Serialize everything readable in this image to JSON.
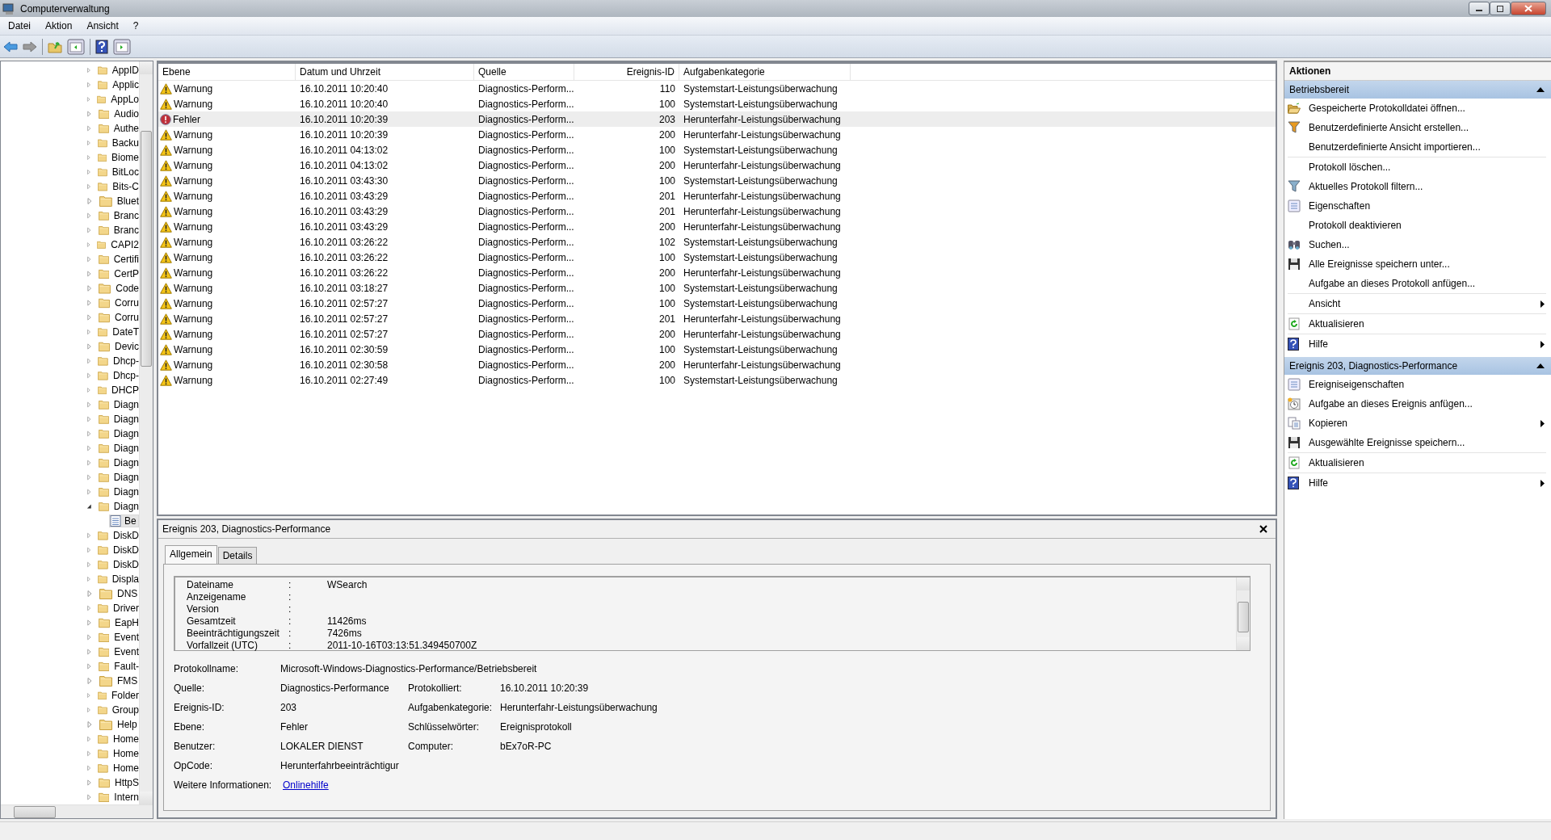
{
  "window": {
    "title": "Computerverwaltung"
  },
  "menu": [
    "Datei",
    "Aktion",
    "Ansicht",
    "?"
  ],
  "tree": {
    "items": [
      {
        "label": "AppID",
        "expanded": false
      },
      {
        "label": "Applic",
        "expanded": false
      },
      {
        "label": "AppLo",
        "expanded": false
      },
      {
        "label": "Audio",
        "expanded": false
      },
      {
        "label": "Authe",
        "expanded": false
      },
      {
        "label": "Backu",
        "expanded": false
      },
      {
        "label": "Biome",
        "expanded": false
      },
      {
        "label": "BitLoc",
        "expanded": false
      },
      {
        "label": "Bits-C",
        "expanded": false
      },
      {
        "label": "Bluet",
        "expanded": false
      },
      {
        "label": "Branc",
        "expanded": false
      },
      {
        "label": "Branc",
        "expanded": false
      },
      {
        "label": "CAPI2",
        "expanded": false
      },
      {
        "label": "Certifi",
        "expanded": false
      },
      {
        "label": "CertP",
        "expanded": false
      },
      {
        "label": "Code",
        "expanded": false
      },
      {
        "label": "Corru",
        "expanded": false
      },
      {
        "label": "Corru",
        "expanded": false
      },
      {
        "label": "DateT",
        "expanded": false
      },
      {
        "label": "Devic",
        "expanded": false
      },
      {
        "label": "Dhcp-",
        "expanded": false
      },
      {
        "label": "Dhcp-",
        "expanded": false
      },
      {
        "label": "DHCP",
        "expanded": false
      },
      {
        "label": "Diagn",
        "expanded": false
      },
      {
        "label": "Diagn",
        "expanded": false
      },
      {
        "label": "Diagn",
        "expanded": false
      },
      {
        "label": "Diagn",
        "expanded": false
      },
      {
        "label": "Diagn",
        "expanded": false
      },
      {
        "label": "Diagn",
        "expanded": false
      },
      {
        "label": "Diagn",
        "expanded": false
      },
      {
        "label": "Diagn",
        "expanded": true,
        "children": [
          {
            "label": "Be",
            "selected": true
          }
        ]
      },
      {
        "label": "DiskD",
        "expanded": false
      },
      {
        "label": "DiskD",
        "expanded": false
      },
      {
        "label": "DiskD",
        "expanded": false
      },
      {
        "label": "Displa",
        "expanded": false
      },
      {
        "label": "DNS",
        "expanded": false
      },
      {
        "label": "Driver",
        "expanded": false
      },
      {
        "label": "EapH",
        "expanded": false
      },
      {
        "label": "Event",
        "expanded": false
      },
      {
        "label": "Event",
        "expanded": false
      },
      {
        "label": "Fault-",
        "expanded": false
      },
      {
        "label": "FMS",
        "expanded": false
      },
      {
        "label": "Folder",
        "expanded": false
      },
      {
        "label": "Group",
        "expanded": false
      },
      {
        "label": "Help",
        "expanded": false
      },
      {
        "label": "Home",
        "expanded": false
      },
      {
        "label": "Home",
        "expanded": false
      },
      {
        "label": "Home",
        "expanded": false
      },
      {
        "label": "HttpS",
        "expanded": false
      },
      {
        "label": "Intern",
        "expanded": false
      }
    ]
  },
  "events": {
    "columns": [
      "Ebene",
      "Datum und Uhrzeit",
      "Quelle",
      "Ereignis-ID",
      "Aufgabenkategorie"
    ],
    "rows": [
      {
        "kind": "warning",
        "level": "Warnung",
        "datetime": "16.10.2011 10:20:40",
        "source": "Diagnostics-Perform...",
        "id": "110",
        "category": "Systemstart-Leistungsüberwachung",
        "selected": false
      },
      {
        "kind": "warning",
        "level": "Warnung",
        "datetime": "16.10.2011 10:20:40",
        "source": "Diagnostics-Perform...",
        "id": "100",
        "category": "Systemstart-Leistungsüberwachung",
        "selected": false
      },
      {
        "kind": "error",
        "level": "Fehler",
        "datetime": "16.10.2011 10:20:39",
        "source": "Diagnostics-Perform...",
        "id": "203",
        "category": "Herunterfahr-Leistungsüberwachung",
        "selected": true
      },
      {
        "kind": "warning",
        "level": "Warnung",
        "datetime": "16.10.2011 10:20:39",
        "source": "Diagnostics-Perform...",
        "id": "200",
        "category": "Herunterfahr-Leistungsüberwachung",
        "selected": false
      },
      {
        "kind": "warning",
        "level": "Warnung",
        "datetime": "16.10.2011 04:13:02",
        "source": "Diagnostics-Perform...",
        "id": "100",
        "category": "Systemstart-Leistungsüberwachung",
        "selected": false
      },
      {
        "kind": "warning",
        "level": "Warnung",
        "datetime": "16.10.2011 04:13:02",
        "source": "Diagnostics-Perform...",
        "id": "200",
        "category": "Herunterfahr-Leistungsüberwachung",
        "selected": false
      },
      {
        "kind": "warning",
        "level": "Warnung",
        "datetime": "16.10.2011 03:43:30",
        "source": "Diagnostics-Perform...",
        "id": "100",
        "category": "Systemstart-Leistungsüberwachung",
        "selected": false
      },
      {
        "kind": "warning",
        "level": "Warnung",
        "datetime": "16.10.2011 03:43:29",
        "source": "Diagnostics-Perform...",
        "id": "201",
        "category": "Herunterfahr-Leistungsüberwachung",
        "selected": false
      },
      {
        "kind": "warning",
        "level": "Warnung",
        "datetime": "16.10.2011 03:43:29",
        "source": "Diagnostics-Perform...",
        "id": "201",
        "category": "Herunterfahr-Leistungsüberwachung",
        "selected": false
      },
      {
        "kind": "warning",
        "level": "Warnung",
        "datetime": "16.10.2011 03:43:29",
        "source": "Diagnostics-Perform...",
        "id": "200",
        "category": "Herunterfahr-Leistungsüberwachung",
        "selected": false
      },
      {
        "kind": "warning",
        "level": "Warnung",
        "datetime": "16.10.2011 03:26:22",
        "source": "Diagnostics-Perform...",
        "id": "102",
        "category": "Systemstart-Leistungsüberwachung",
        "selected": false
      },
      {
        "kind": "warning",
        "level": "Warnung",
        "datetime": "16.10.2011 03:26:22",
        "source": "Diagnostics-Perform...",
        "id": "100",
        "category": "Systemstart-Leistungsüberwachung",
        "selected": false
      },
      {
        "kind": "warning",
        "level": "Warnung",
        "datetime": "16.10.2011 03:26:22",
        "source": "Diagnostics-Perform...",
        "id": "200",
        "category": "Herunterfahr-Leistungsüberwachung",
        "selected": false
      },
      {
        "kind": "warning",
        "level": "Warnung",
        "datetime": "16.10.2011 03:18:27",
        "source": "Diagnostics-Perform...",
        "id": "100",
        "category": "Systemstart-Leistungsüberwachung",
        "selected": false
      },
      {
        "kind": "warning",
        "level": "Warnung",
        "datetime": "16.10.2011 02:57:27",
        "source": "Diagnostics-Perform...",
        "id": "100",
        "category": "Systemstart-Leistungsüberwachung",
        "selected": false
      },
      {
        "kind": "warning",
        "level": "Warnung",
        "datetime": "16.10.2011 02:57:27",
        "source": "Diagnostics-Perform...",
        "id": "201",
        "category": "Herunterfahr-Leistungsüberwachung",
        "selected": false
      },
      {
        "kind": "warning",
        "level": "Warnung",
        "datetime": "16.10.2011 02:57:27",
        "source": "Diagnostics-Perform...",
        "id": "200",
        "category": "Herunterfahr-Leistungsüberwachung",
        "selected": false
      },
      {
        "kind": "warning",
        "level": "Warnung",
        "datetime": "16.10.2011 02:30:59",
        "source": "Diagnostics-Perform...",
        "id": "100",
        "category": "Systemstart-Leistungsüberwachung",
        "selected": false
      },
      {
        "kind": "warning",
        "level": "Warnung",
        "datetime": "16.10.2011 02:30:58",
        "source": "Diagnostics-Perform...",
        "id": "200",
        "category": "Herunterfahr-Leistungsüberwachung",
        "selected": false
      },
      {
        "kind": "warning",
        "level": "Warnung",
        "datetime": "16.10.2011 02:27:49",
        "source": "Diagnostics-Perform...",
        "id": "100",
        "category": "Systemstart-Leistungsüberwachung",
        "selected": false
      }
    ]
  },
  "detail": {
    "title": "Ereignis 203, Diagnostics-Performance",
    "tabs": [
      {
        "label": "Allgemein",
        "selected": true
      },
      {
        "label": "Details",
        "selected": false
      }
    ],
    "data_lines": [
      {
        "name": "Dateiname",
        "sep": ":",
        "value": "WSearch"
      },
      {
        "name": "Anzeigename",
        "sep": ":"
      },
      {
        "name": "Version",
        "sep": ":"
      },
      {
        "name": "Gesamtzeit",
        "sep": ":",
        "value": "11426ms"
      },
      {
        "name": "Beeinträchtigungszeit",
        "sep": ":",
        "value": "7426ms"
      },
      {
        "name": "Vorfallzeit (UTC)",
        "sep": ":",
        "value": "2011-10-16T03:13:51.349450700Z"
      }
    ],
    "fields": [
      [
        {
          "label": "Protokollname:",
          "value": "Microsoft-Windows-Diagnostics-Performance/Betriebsbereit"
        }
      ],
      [
        {
          "label": "Quelle:",
          "value": "Diagnostics-Performance"
        },
        {
          "label": "Protokolliert:",
          "value": "16.10.2011 10:20:39"
        }
      ],
      [
        {
          "label": "Ereignis-ID:",
          "value": "203"
        },
        {
          "label": "Aufgabenkategorie:",
          "value": "Herunterfahr-Leistungsüberwachung"
        }
      ],
      [
        {
          "label": "Ebene:",
          "value": "Fehler"
        },
        {
          "label": "Schlüsselwörter:",
          "value": "Ereignisprotokoll"
        }
      ],
      [
        {
          "label": "Benutzer:",
          "value": "LOKALER DIENST"
        },
        {
          "label": "Computer:",
          "value": "bEx7oR-PC"
        }
      ],
      [
        {
          "label": "OpCode:",
          "value": "Herunterfahrbeeinträchtigur"
        }
      ]
    ],
    "more_info": {
      "label": "Weitere Informationen:",
      "link": "Onlinehilfe"
    }
  },
  "actions": {
    "title": "Aktionen",
    "sections": [
      {
        "title": "Betriebsbereit",
        "expanded": true,
        "groups": [
          [
            {
              "label": "Gespeicherte Protokolldatei öffnen...",
              "kind": "folder",
              "submenu": false
            },
            {
              "label": "Benutzerdefinierte Ansicht erstellen...",
              "kind": "funnel-color",
              "submenu": false
            },
            {
              "label": "Benutzerdefinierte Ansicht importieren...",
              "kind": "plain",
              "submenu": false
            }
          ],
          [
            {
              "label": "Protokoll löschen...",
              "kind": "plain",
              "submenu": false
            },
            {
              "label": "Aktuelles Protokoll filtern...",
              "kind": "funnel",
              "submenu": false
            },
            {
              "label": "Eigenschaften",
              "kind": "properties",
              "submenu": false
            },
            {
              "label": "Protokoll deaktivieren",
              "kind": "plain",
              "submenu": false
            },
            {
              "label": "Suchen...",
              "kind": "binoculars",
              "submenu": false
            },
            {
              "label": "Alle Ereignisse speichern unter...",
              "kind": "floppy",
              "submenu": false
            },
            {
              "label": "Aufgabe an dieses Protokoll anfügen...",
              "kind": "plain",
              "submenu": false
            }
          ],
          [
            {
              "label": "Ansicht",
              "kind": "plain",
              "submenu": true
            }
          ],
          [
            {
              "label": "Aktualisieren",
              "kind": "refresh",
              "submenu": false
            }
          ],
          [
            {
              "label": "Hilfe",
              "kind": "help",
              "submenu": true
            }
          ]
        ]
      },
      {
        "title": "Ereignis 203, Diagnostics-Performance",
        "expanded": true,
        "groups": [
          [
            {
              "label": "Ereigniseigenschaften",
              "kind": "properties",
              "submenu": false
            },
            {
              "label": "Aufgabe an dieses Ereignis anfügen...",
              "kind": "task",
              "submenu": false
            },
            {
              "label": "Kopieren",
              "kind": "copy",
              "submenu": true
            },
            {
              "label": "Ausgewählte Ereignisse speichern...",
              "kind": "floppy",
              "submenu": false
            }
          ],
          [
            {
              "label": "Aktualisieren",
              "kind": "refresh",
              "submenu": false
            }
          ],
          [
            {
              "label": "Hilfe",
              "kind": "help",
              "submenu": true
            }
          ]
        ]
      }
    ]
  }
}
